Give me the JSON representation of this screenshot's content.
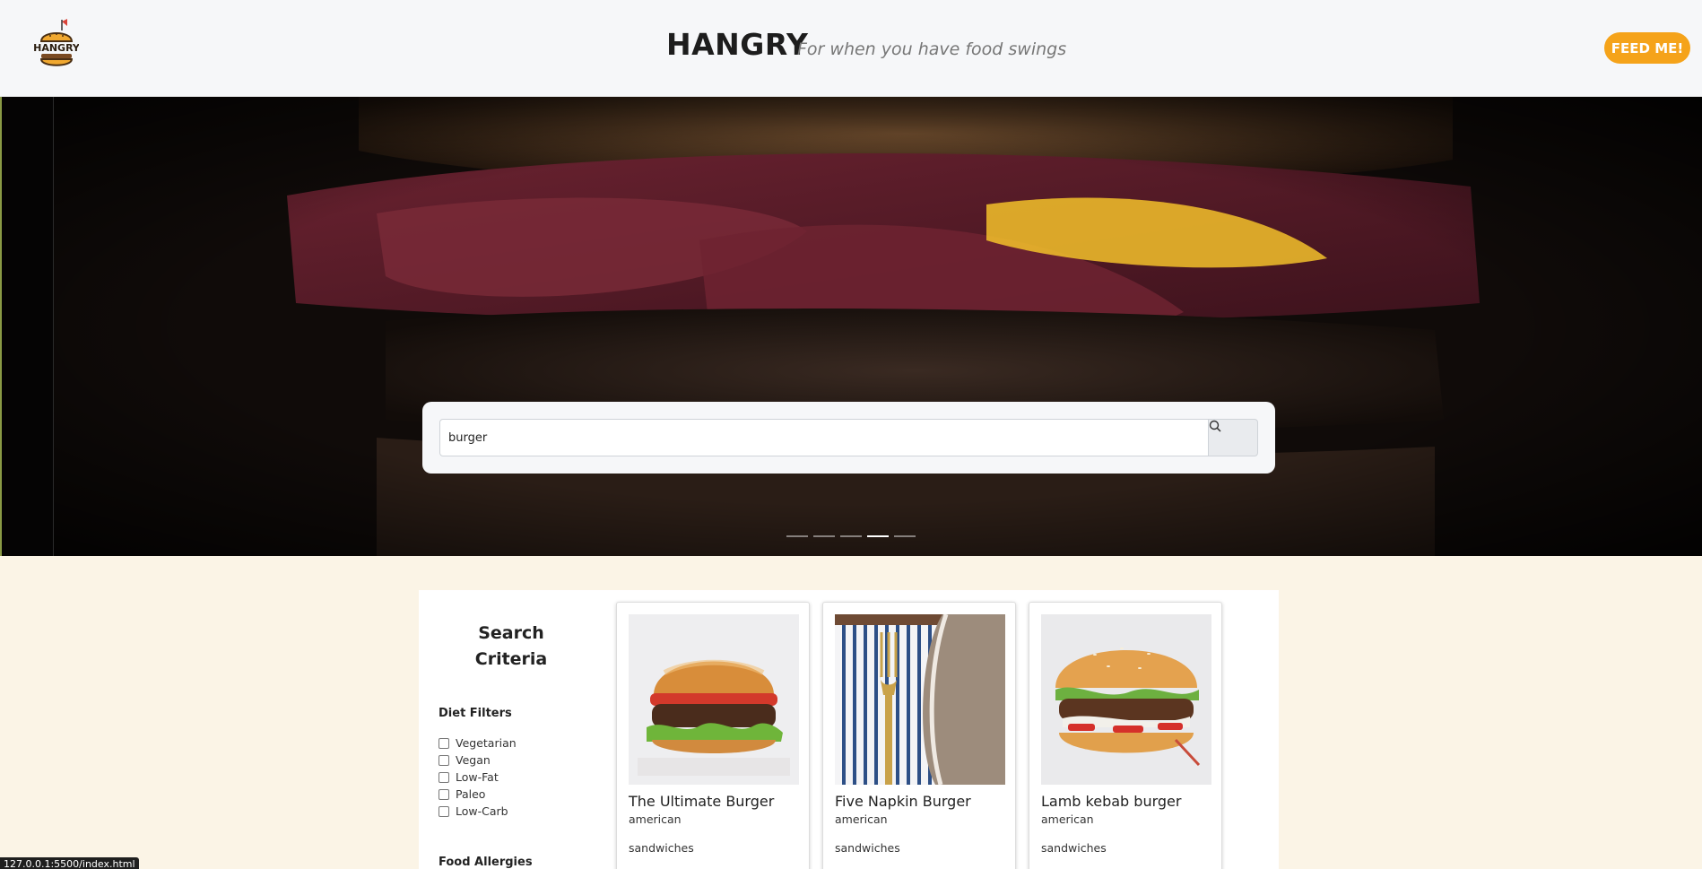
{
  "header": {
    "logo_text": "HANGRY",
    "brand": "HANGRY",
    "tagline": "For when you have food swings",
    "feed_button": "FEED ME!"
  },
  "hero": {
    "search_value": "burger",
    "search_icon": "search-icon",
    "carousel_total": 5,
    "carousel_active": 4
  },
  "sidebar": {
    "title": "Search Criteria",
    "diet_title": "Diet Filters",
    "diet_filters": [
      "Vegetarian",
      "Vegan",
      "Low-Fat",
      "Paleo",
      "Low-Carb"
    ],
    "allergies_title": "Food Allergies"
  },
  "results": [
    {
      "title": "The Ultimate Burger",
      "cuisine": "american",
      "category": "sandwiches"
    },
    {
      "title": "Five Napkin Burger",
      "cuisine": "american",
      "category": "sandwiches"
    },
    {
      "title": "Lamb kebab burger",
      "cuisine": "american",
      "category": "sandwiches"
    }
  ],
  "status_bar": {
    "url": "127.0.0.1:5500/index.html"
  },
  "colors": {
    "accent": "#f5a31a",
    "header_bg": "#f6f7f9",
    "page_bg": "#fbf4e6"
  }
}
